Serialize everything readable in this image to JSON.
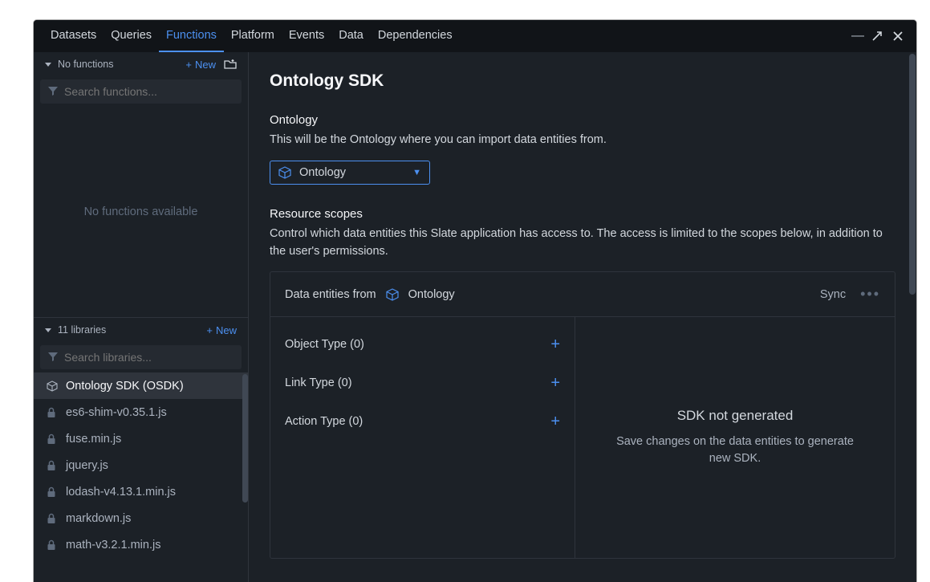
{
  "tabs": [
    "Datasets",
    "Queries",
    "Functions",
    "Platform",
    "Events",
    "Data",
    "Dependencies"
  ],
  "active_tab_index": 2,
  "sidebar": {
    "functions": {
      "header": "No functions",
      "new_label": "New",
      "search_placeholder": "Search functions...",
      "empty_msg": "No functions available"
    },
    "libraries": {
      "header": "11 libraries",
      "new_label": "New",
      "search_placeholder": "Search libraries...",
      "items": [
        {
          "label": "Ontology SDK (OSDK)",
          "icon": "cube",
          "selected": true
        },
        {
          "label": "es6-shim-v0.35.1.js",
          "icon": "lock",
          "selected": false
        },
        {
          "label": "fuse.min.js",
          "icon": "lock",
          "selected": false
        },
        {
          "label": "jquery.js",
          "icon": "lock",
          "selected": false
        },
        {
          "label": "lodash-v4.13.1.min.js",
          "icon": "lock",
          "selected": false
        },
        {
          "label": "markdown.js",
          "icon": "lock",
          "selected": false
        },
        {
          "label": "math-v3.2.1.min.js",
          "icon": "lock",
          "selected": false
        }
      ]
    }
  },
  "main": {
    "title": "Ontology SDK",
    "ontology_section": {
      "label": "Ontology",
      "desc": "This will be the Ontology where you can import data entities from.",
      "selected": "Ontology"
    },
    "scopes_section": {
      "label": "Resource scopes",
      "desc": "Control which data entities this Slate application has access to. The access is limited to the scopes below, in addition to the user's permissions."
    },
    "panel": {
      "header_prefix": "Data entities from",
      "header_ontology": "Ontology",
      "sync_label": "Sync",
      "types": [
        {
          "label": "Object Type (0)"
        },
        {
          "label": "Link Type (0)"
        },
        {
          "label": "Action Type (0)"
        }
      ],
      "empty_title": "SDK not generated",
      "empty_desc": "Save changes on the data entities to generate new SDK."
    }
  }
}
